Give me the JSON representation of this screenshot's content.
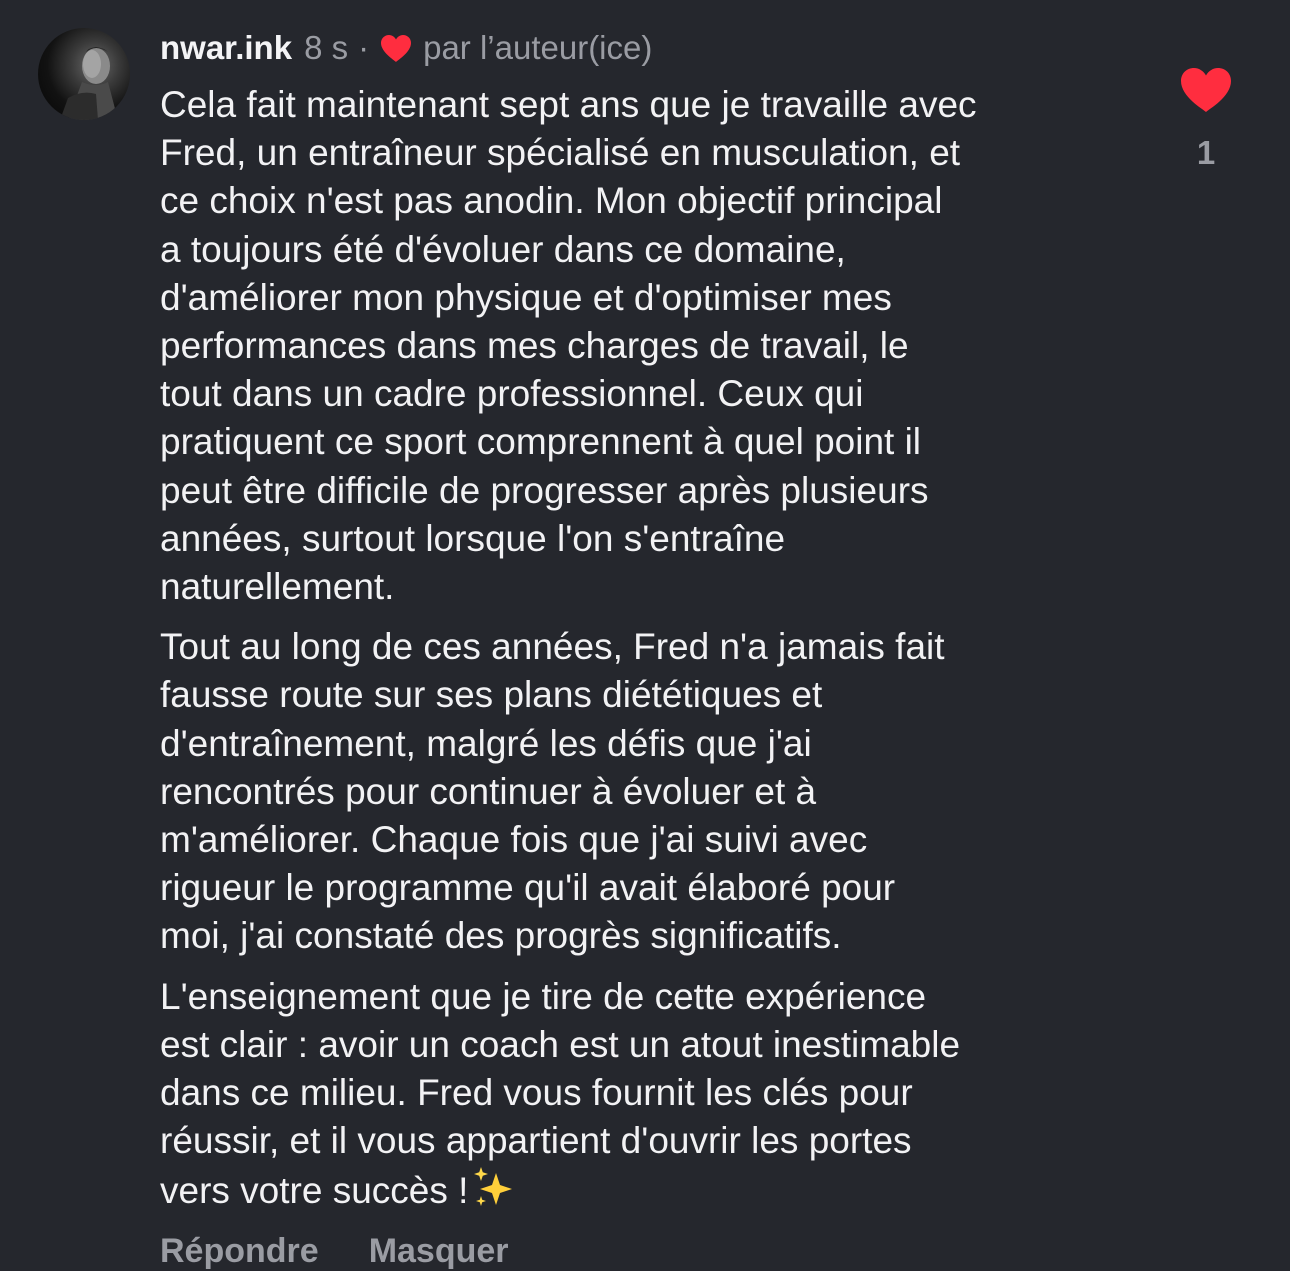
{
  "comment": {
    "username": "nwar.ink",
    "time": "8 s",
    "separator": "·",
    "author_like_label": "par l’auteur(ice)",
    "paragraphs": [
      "Cela fait maintenant sept ans que je travaille avec\nFred, un entraîneur spécialisé en musculation, et\nce choix n'est pas anodin. Mon objectif principal\na toujours été d'évoluer dans ce domaine,\nd'améliorer mon physique et d'optimiser mes\nperformances dans mes charges de travail, le\ntout dans un cadre professionnel. Ceux qui\npratiquent ce sport comprennent à quel point il\npeut être difficile de progresser après plusieurs\nannées, surtout lorsque l'on s'entraîne\nnaturellement.",
      "Tout au long de ces années, Fred n'a jamais fait\nfausse route sur ses plans diététiques et\nd'entraînement, malgré les défis que j'ai\nrencontrés pour continuer à évoluer et à\nm'améliorer. Chaque fois que j'ai suivi avec\nrigueur le programme qu'il avait élaboré pour\nmoi, j'ai constaté des progrès significatifs.",
      "L'enseignement que je tire de cette expérience\nest clair : avoir un coach est un atout inestimable\ndans ce milieu. Fred vous fournit les clés pour\nréussir, et il vous appartient d'ouvrir les portes\nvers votre succès !"
    ],
    "like_count": "1",
    "actions": {
      "reply": "Répondre",
      "hide": "Masquer"
    }
  },
  "colors": {
    "background": "#25272d",
    "text": "#f2f2f4",
    "muted": "#9a9ca3",
    "heart": "#ff2d3f"
  },
  "icons": {
    "author_like": "heart-filled-icon",
    "like": "heart-filled-icon",
    "emoji": "sparkles-icon"
  }
}
